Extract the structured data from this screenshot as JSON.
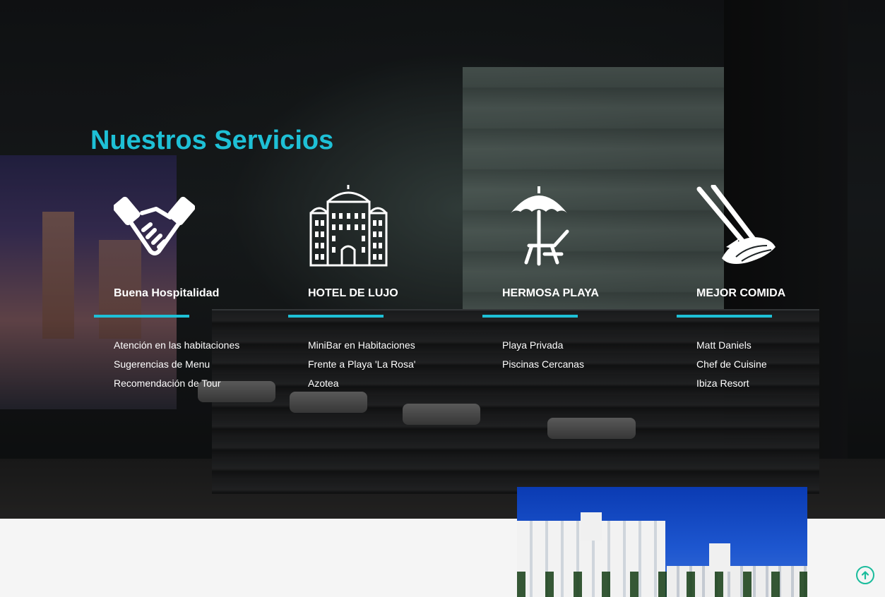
{
  "services": {
    "title": "Nuestros Servicios",
    "items": [
      {
        "icon": "handshake-icon",
        "title": "Buena Hospitalidad",
        "features": [
          "Atención en las habitaciones",
          "Sugerencias de Menu",
          "Recomendación de Tour"
        ]
      },
      {
        "icon": "hotel-building-icon",
        "title": "HOTEL DE LUJO",
        "features": [
          "MiniBar en Habitaciones",
          "Frente a Playa 'La Rosa'",
          "Azotea"
        ]
      },
      {
        "icon": "beach-umbrella-icon",
        "title": "HERMOSA PLAYA",
        "features": [
          "Playa Privada",
          "Piscinas Cercanas"
        ]
      },
      {
        "icon": "sushi-chopsticks-icon",
        "title": "MEJOR COMIDA",
        "features": [
          "Matt Daniels",
          "Chef de Cuisine",
          "Ibiza Resort"
        ]
      }
    ]
  },
  "colors": {
    "accent": "#1ec0d6",
    "scroll_top": "#1abc9c"
  }
}
